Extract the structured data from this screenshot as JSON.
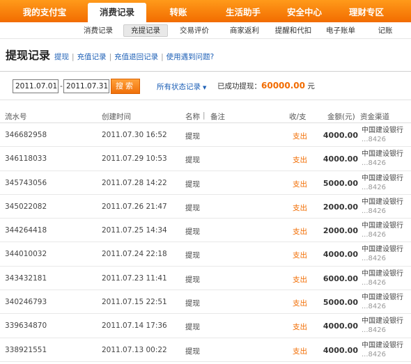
{
  "top_nav": [
    {
      "label": "我的支付宝"
    },
    {
      "label": "消费记录",
      "active": true
    },
    {
      "label": "转账"
    },
    {
      "label": "生活助手"
    },
    {
      "label": "安全中心"
    },
    {
      "label": "理财专区"
    }
  ],
  "sub_nav": [
    {
      "label": "消费记录"
    },
    {
      "label": "充提记录",
      "active": true
    },
    {
      "label": "交易评价"
    },
    {
      "label": "商家返利"
    },
    {
      "label": "提醒和代扣"
    },
    {
      "label": "电子账单"
    },
    {
      "label": "记账"
    }
  ],
  "page": {
    "title": "提现记录",
    "links": [
      "提现",
      "充值记录",
      "充值退回记录",
      "使用遇到问题?"
    ]
  },
  "filter": {
    "start_date": "2011.07.01",
    "end_date": "2011.07.31",
    "dash": "-",
    "search_label": "搜索",
    "status_select": "所有状态记录",
    "total_label": "已成功提现：",
    "total_amount": "60000.00",
    "total_unit": "元"
  },
  "table": {
    "headers": {
      "serial": "流水号",
      "created": "创建时间",
      "name": "名称",
      "divider": "|",
      "remark": "备注",
      "direction": "收/支",
      "amount": "金额(元)",
      "channel": "资金渠道"
    },
    "rows": [
      {
        "serial": "346682958",
        "created": "2011.07.30 16:52",
        "name": "提现",
        "direction": "支出",
        "amount": "4000.00",
        "bank": "中国建设银行",
        "account": "...8426"
      },
      {
        "serial": "346118033",
        "created": "2011.07.29 10:53",
        "name": "提现",
        "direction": "支出",
        "amount": "4000.00",
        "bank": "中国建设银行",
        "account": "...8426"
      },
      {
        "serial": "345743056",
        "created": "2011.07.28 14:22",
        "name": "提现",
        "direction": "支出",
        "amount": "5000.00",
        "bank": "中国建设银行",
        "account": "...8426"
      },
      {
        "serial": "345022082",
        "created": "2011.07.26 21:47",
        "name": "提现",
        "direction": "支出",
        "amount": "2000.00",
        "bank": "中国建设银行",
        "account": "...8426"
      },
      {
        "serial": "344264418",
        "created": "2011.07.25 14:34",
        "name": "提现",
        "direction": "支出",
        "amount": "2000.00",
        "bank": "中国建设银行",
        "account": "...8426"
      },
      {
        "serial": "344010032",
        "created": "2011.07.24 22:18",
        "name": "提现",
        "direction": "支出",
        "amount": "4000.00",
        "bank": "中国建设银行",
        "account": "...8426"
      },
      {
        "serial": "343432181",
        "created": "2011.07.23 11:41",
        "name": "提现",
        "direction": "支出",
        "amount": "6000.00",
        "bank": "中国建设银行",
        "account": "...8426"
      },
      {
        "serial": "340246793",
        "created": "2011.07.15 22:51",
        "name": "提现",
        "direction": "支出",
        "amount": "5000.00",
        "bank": "中国建设银行",
        "account": "...8426"
      },
      {
        "serial": "339634870",
        "created": "2011.07.14 17:36",
        "name": "提现",
        "direction": "支出",
        "amount": "4000.00",
        "bank": "中国建设银行",
        "account": "...8426"
      },
      {
        "serial": "338921551",
        "created": "2011.07.13 00:22",
        "name": "提现",
        "direction": "支出",
        "amount": "4000.00",
        "bank": "中国建设银行",
        "account": "...8426"
      }
    ]
  }
}
